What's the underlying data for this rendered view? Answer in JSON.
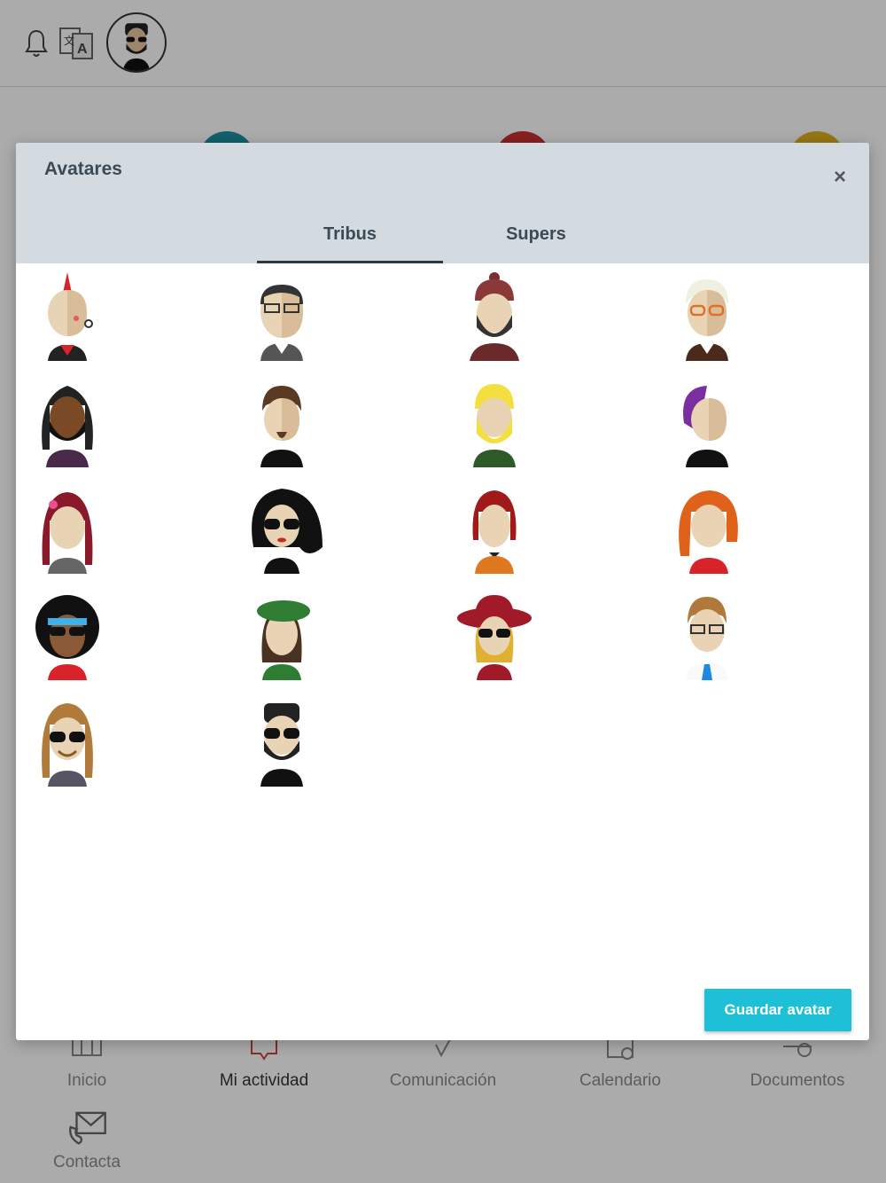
{
  "modal": {
    "title": "Avatares",
    "close_icon": "×",
    "tabs": [
      {
        "label": "Tribus",
        "active": true
      },
      {
        "label": "Supers",
        "active": false
      }
    ],
    "save_label": "Guardar avatar",
    "save_color": "#1ec0d8"
  },
  "avatars": [
    "punk-avatar",
    "bald-glasses-avatar",
    "beanie-beard-avatar",
    "white-hair-glasses-avatar",
    "dreadlocks-avatar",
    "goatee-avatar",
    "yellow-beard-avatar",
    "purple-hair-avatar",
    "red-hair-flower-avatar",
    "black-hair-sunglasses-avatar",
    "red-bob-avatar",
    "orange-hair-avatar",
    "afro-headband-avatar",
    "beret-avatar",
    "red-hat-sunglasses-avatar",
    "glasses-tie-avatar",
    "long-hair-sunglasses-avatar",
    "beard-sunglasses-avatar"
  ],
  "nav": [
    {
      "label": "Inicio",
      "icon": "home-icon"
    },
    {
      "label": "Mi actividad",
      "icon": "activity-icon"
    },
    {
      "label": "Comunicación",
      "icon": "communication-icon"
    },
    {
      "label": "Calendario",
      "icon": "calendar-icon"
    },
    {
      "label": "Documentos",
      "icon": "documents-icon"
    },
    {
      "label": "Contacta",
      "icon": "contact-icon"
    }
  ]
}
